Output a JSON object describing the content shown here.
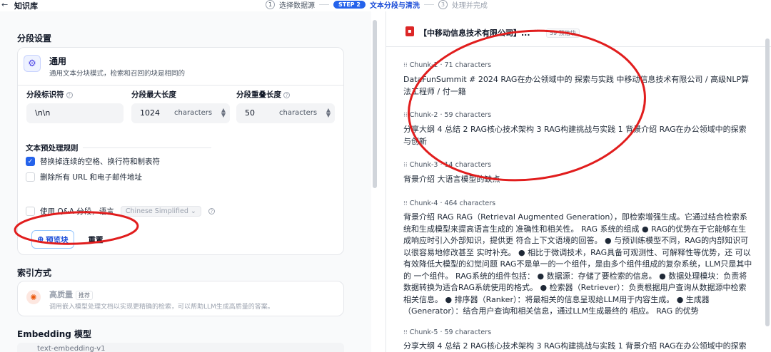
{
  "header": {
    "back_icon": "←",
    "title": "知识库",
    "steps": [
      {
        "num": "1",
        "label": "选择数据源"
      },
      {
        "pill": "STEP 2",
        "label": "文本分段与清洗"
      },
      {
        "num": "3",
        "label": "处理并完成"
      }
    ]
  },
  "segment": {
    "title": "分段设置",
    "mode_name": "通用",
    "mode_desc": "通用文本分块模式，检索和召回的块是相同的",
    "separator_label": "分段标识符",
    "separator_value": "\\n\\n",
    "max_len_label": "分段最大长度",
    "max_len_value": "1024",
    "max_len_unit": "characters",
    "overlap_label": "分段重叠长度",
    "overlap_value": "50",
    "overlap_unit": "characters",
    "rules_title": "文本预处理规则",
    "rule1": "替换掉连续的空格、换行符和制表符",
    "rule1_checked": true,
    "rule2": "删除所有 URL 和电子邮件地址",
    "rule2_checked": false,
    "qa_label": "使用 Q&A 分段，语言",
    "qa_lang": "Chinese Simplified",
    "preview_button": "预览块",
    "reset_button": "重置"
  },
  "index": {
    "title": "索引方式",
    "name": "高质量",
    "badge": "推荐",
    "desc": "调用嵌入模型处理文档以实现更精确的检索，可以帮助LLM生成高质量的答案。"
  },
  "embedding": {
    "title": "Embedding 模型",
    "value": "text-embedding-v1"
  },
  "preview": {
    "doc_name": "【中移动信息技术有限公司】...",
    "doc_count": "59 预估块",
    "chunks": [
      {
        "head": "Chunk-1 · 71 characters",
        "body": "DataFunSummit # 2024 RAG在办公领域中的 探索与实践 中移动信息技术有限公司 / 高级NLP算法工程师 / 付一籍"
      },
      {
        "head": "Chunk-2 · 59 characters",
        "body": "分享大纲 4 总结 2 RAG核心技术架构 3 RAG构建挑战与实践 1 背景介绍 RAG在办公领域中的探索与创新"
      },
      {
        "head": "Chunk-3 · 14 characters",
        "body": "背景介绍 大语言模型的缺点"
      },
      {
        "head": "Chunk-4 · 464 characters",
        "body": "背景介绍 RAG RAG（Retrieval Augmented Generation），即检索增强生成。它通过结合检索系统和生成模型来提高语言生成的 准确性和相关性。 RAG 系统的组成 ● RAG的优势在于它能够在生成响应时引入外部知识，提供更 符合上下文语境的回答。 ● 与预训练模型不同，RAG的内部知识可以很容易地修改甚至 实时补充。 ● 相比于微调技术，RAG具备可观测性、可解释性等优势，还 可以有效降低大模型的幻觉问题 RAG不是单一的一个组件，是由多个组件组成的复杂系统，LLM只是其中的 一个组件。 RAG系统的组件包括： ● 数据源：存储了要检索的信息。 ● 数据处理模块：负责将数据转换为适合RAG系统使用的格式。 ● 检索器（Retriever）：负责根据用户查询从数据源中检索相关信息。 ● 排序器（Ranker）：将最相关的信息呈现给LLM用于内容生成。 ● 生成器（Generator）：结合用户查询和相关信息，通过LLM生成最终的 相应。 RAG 的优势"
      },
      {
        "head": "Chunk-5 · 59 characters",
        "body": "分享大纲 4 总结 2 RAG核心技术架构 3 RAG构建挑战与实践 1 背景介绍 RAG在办公领域中的探索"
      }
    ]
  },
  "colors": {
    "accent": "#2563eb",
    "annotation": "#e11d1d"
  }
}
